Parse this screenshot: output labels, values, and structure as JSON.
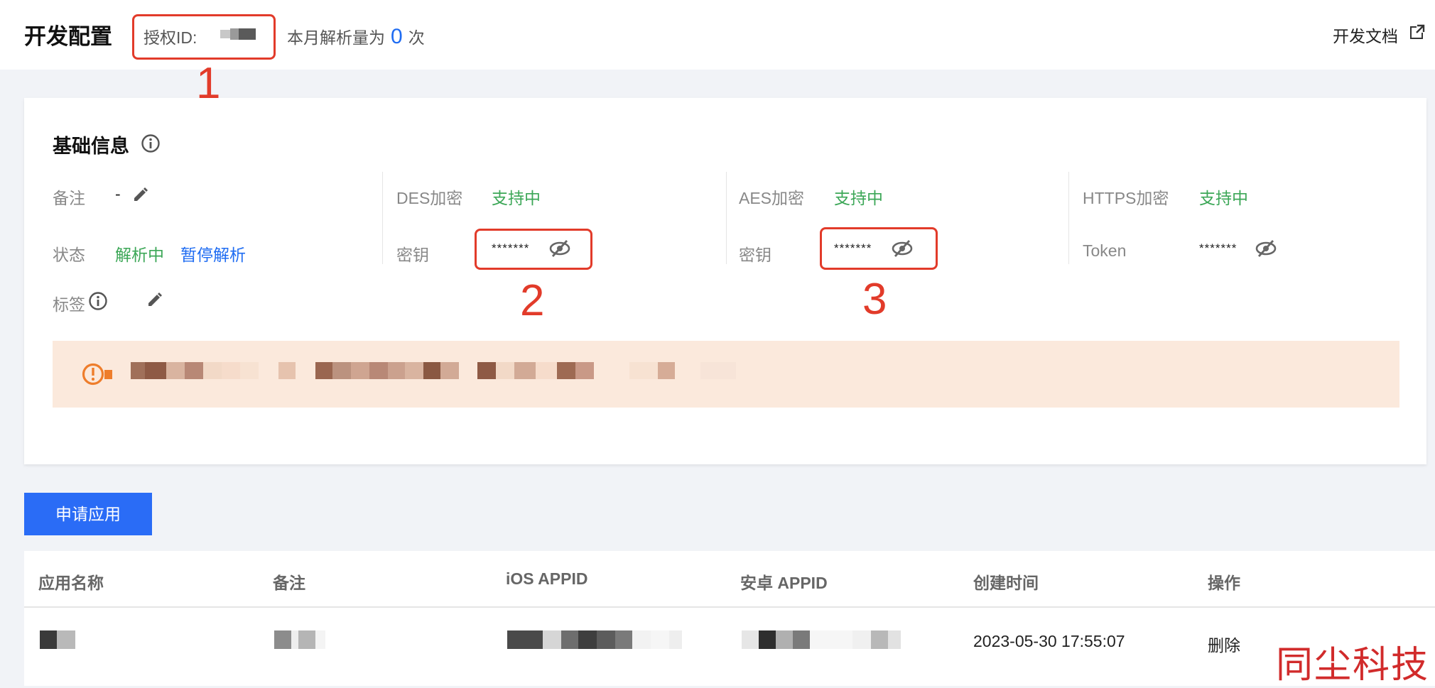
{
  "header": {
    "title": "开发配置",
    "auth_id_label": "授权ID:",
    "monthly_prefix": "本月解析量为",
    "monthly_count": "0",
    "monthly_suffix": "次",
    "dev_doc_label": "开发文档"
  },
  "annotations": {
    "n1": "1",
    "n2": "2",
    "n3": "3"
  },
  "basic_info": {
    "title": "基础信息",
    "remark_label": "备注",
    "remark_value": "-",
    "status_label": "状态",
    "status_value": "解析中",
    "pause_label": "暂停解析",
    "tag_label": "标签",
    "des_label": "DES加密",
    "des_status": "支持中",
    "des_key_label": "密钥",
    "des_key_value": "*******",
    "aes_label": "AES加密",
    "aes_status": "支持中",
    "aes_key_label": "密钥",
    "aes_key_value": "*******",
    "https_label": "HTTPS加密",
    "https_status": "支持中",
    "token_label": "Token",
    "token_value": "*******"
  },
  "apply_button": "申请应用",
  "table": {
    "headers": [
      "应用名称",
      "备注",
      "iOS APPID",
      "安卓 APPID",
      "创建时间",
      "操作"
    ],
    "rows": [
      {
        "created": "2023-05-30 17:55:07",
        "action": "删除"
      }
    ]
  },
  "watermark": "同尘科技",
  "colors": {
    "primary_blue": "#1f6cf2",
    "success_green": "#3ca757",
    "annotation_red": "#e23b2a",
    "notice_bg": "#fbe9dc",
    "warning_orange": "#ee7d2b"
  }
}
